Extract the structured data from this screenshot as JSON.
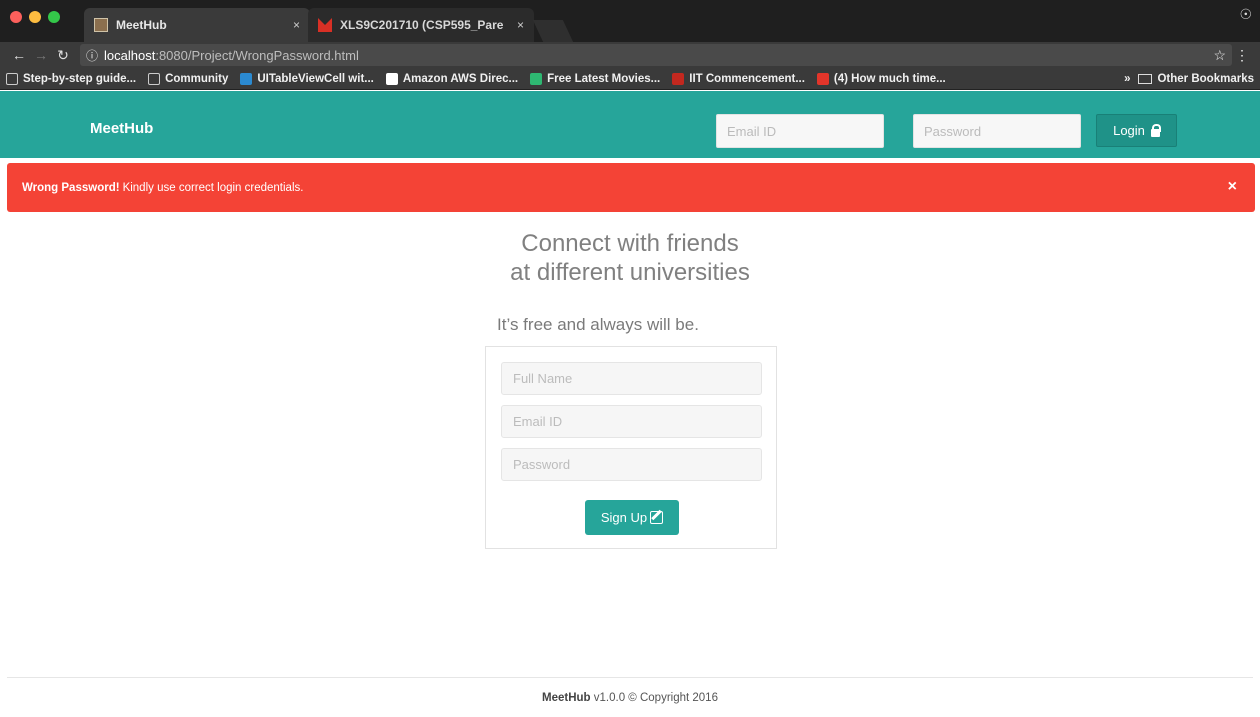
{
  "browser": {
    "tabs": [
      {
        "title": "MeetHub",
        "close": "×",
        "icon": "meethub-favicon"
      },
      {
        "title": "XLS9C201710 (CSP595_Pare",
        "close": "×",
        "icon": "gmail-icon"
      }
    ],
    "url_host": "localhost",
    "url_path": ":8080/Project/WrongPassword.html",
    "bookmarks": [
      {
        "label": "Step-by-step guide...",
        "icon": "page-icon"
      },
      {
        "label": "Community",
        "icon": "page-icon"
      },
      {
        "label": "UITableViewCell wit...",
        "icon": "wordpress-icon"
      },
      {
        "label": "Amazon AWS Direc...",
        "icon": "r-icon"
      },
      {
        "label": "Free Latest Movies...",
        "icon": "play-icon"
      },
      {
        "label": "IIT Commencement...",
        "icon": "iit-icon"
      },
      {
        "label": "(4) How much time...",
        "icon": "quora-icon"
      }
    ],
    "other_bookmarks": "Other Bookmarks",
    "overflow": "»"
  },
  "navbar": {
    "brand": "MeetHub",
    "email_placeholder": "Email ID",
    "password_placeholder": "Password",
    "login_label": "Login"
  },
  "alert": {
    "strong": "Wrong Password!",
    "message": "Kindly use correct login credentials.",
    "close": "×",
    "color": "#f44336"
  },
  "main": {
    "headline_1": "Connect with friends",
    "headline_2": "at different universities",
    "subline": "It’s free and always will be."
  },
  "signup": {
    "fullname_placeholder": "Full Name",
    "email_placeholder": "Email ID",
    "password_placeholder": "Password",
    "button_label": "Sign Up"
  },
  "footer": {
    "brand": "MeetHub",
    "text": "v1.0.0 © Copyright 2016"
  },
  "colors": {
    "accent": "#26a59a",
    "alert": "#f44336"
  }
}
